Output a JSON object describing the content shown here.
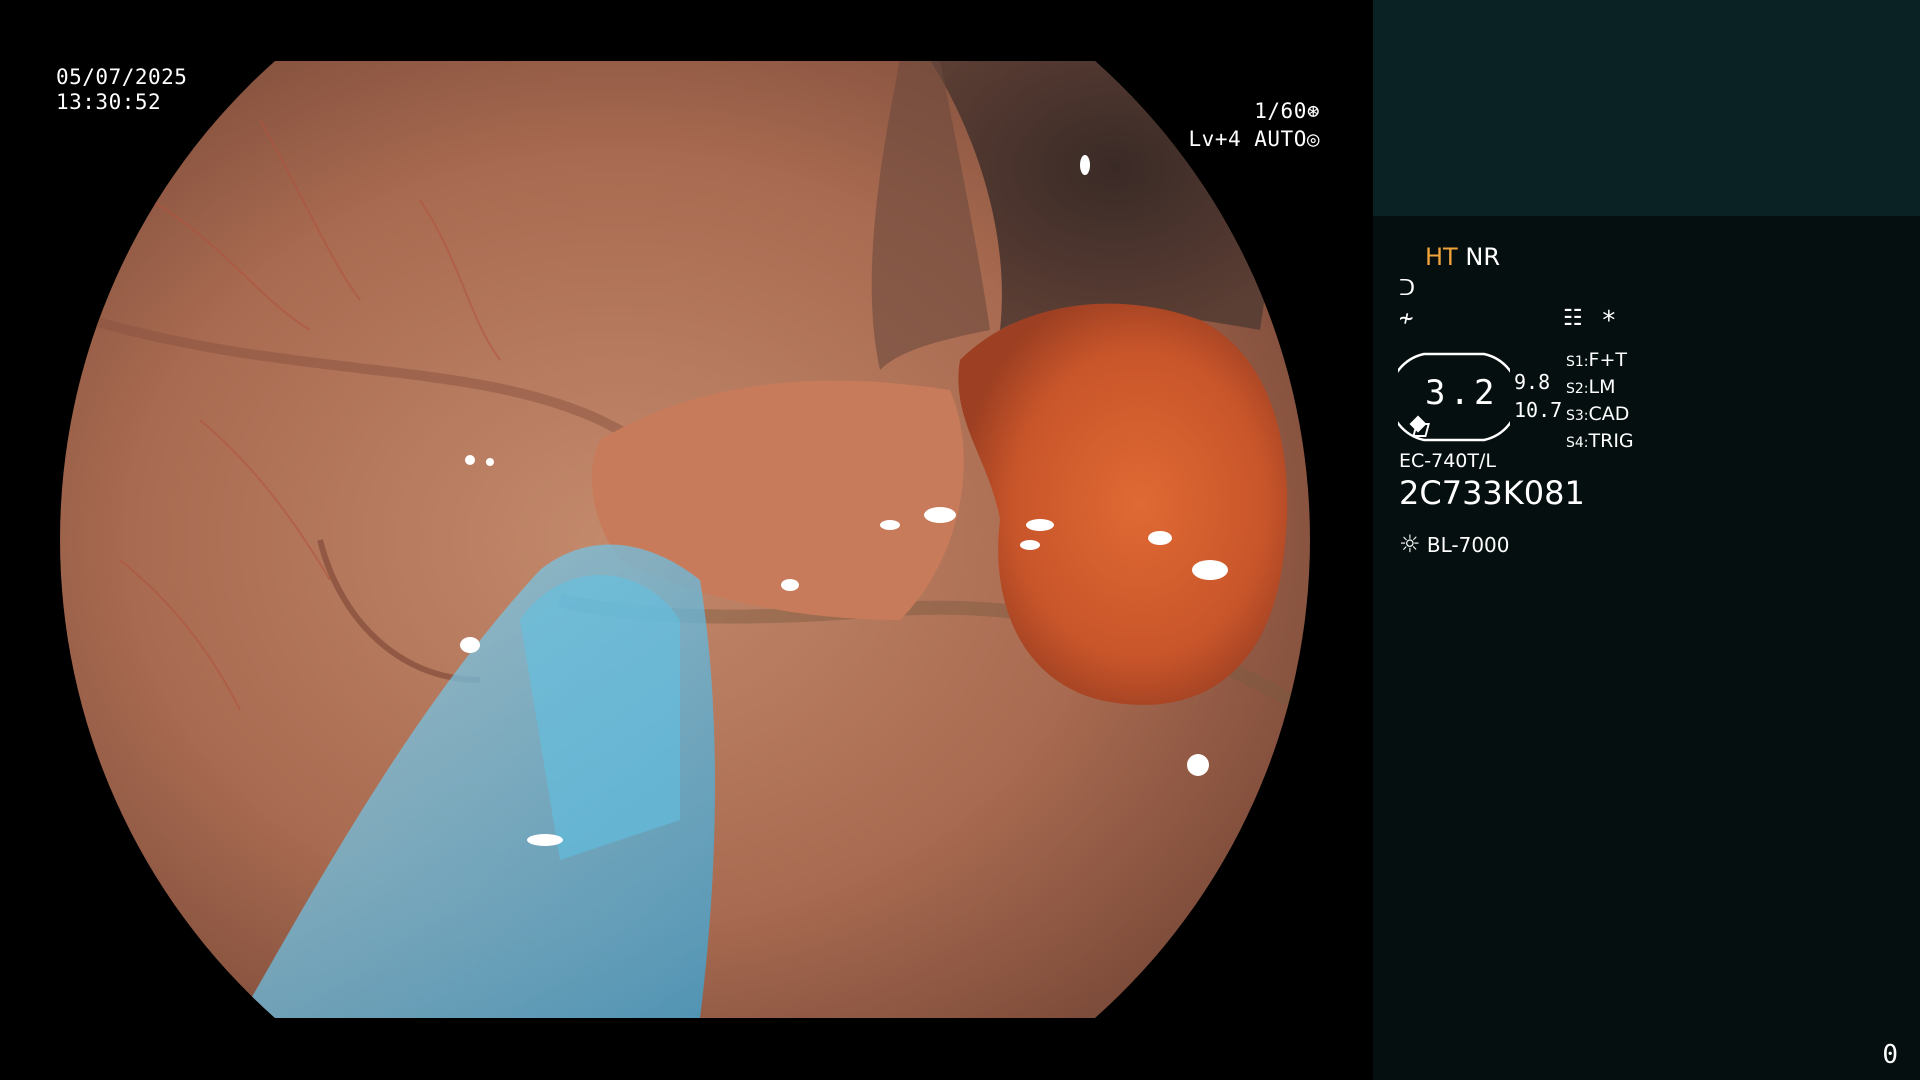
{
  "overlay": {
    "date": "05/07/2025",
    "time": "13:30:52",
    "shutter": "1/60",
    "level": "Lv+4",
    "mode": "AUTO"
  },
  "panel": {
    "ht": "HT",
    "nr": "NR",
    "gauge_value": "3.2",
    "value_a": "9.8",
    "value_b": "10.7",
    "switches": [
      {
        "key": "S1:",
        "label": "F+T"
      },
      {
        "key": "S2:",
        "label": "LM"
      },
      {
        "key": "S3:",
        "label": "CAD"
      },
      {
        "key": "S4:",
        "label": "TRIG"
      }
    ],
    "asterisk": "*",
    "scope_model": "EC-740T/L",
    "serial": "2C733K081",
    "light_source": "BL-7000",
    "counter": "0"
  },
  "colors": {
    "panel_top": "#0b2224",
    "panel_bg": "#050f0f",
    "ht_accent": "#f0a33a"
  }
}
